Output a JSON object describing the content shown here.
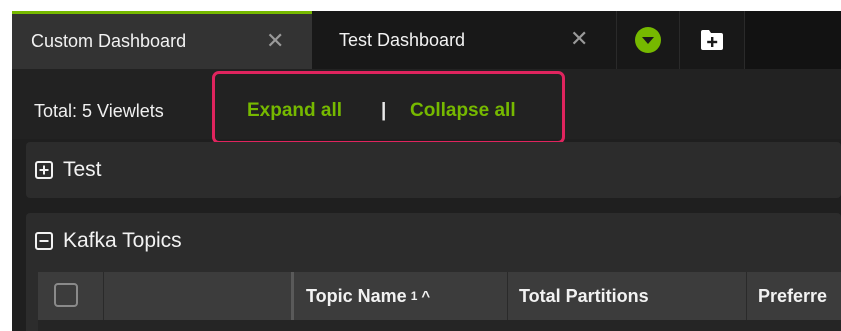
{
  "tabs": [
    {
      "label": "Custom Dashboard",
      "active": true
    },
    {
      "label": "Test Dashboard",
      "active": false
    }
  ],
  "toolbar": {
    "total_label": "Total: 5 Viewlets",
    "expand_all": "Expand all",
    "separator": "|",
    "collapse_all": "Collapse all"
  },
  "panels": [
    {
      "title": "Test",
      "state": "collapsed"
    },
    {
      "title": "Kafka Topics",
      "state": "expanded"
    }
  ],
  "table": {
    "columns": [
      {
        "label": "Topic Name",
        "sort_order": "1",
        "sort_dir": "^"
      },
      {
        "label": "Total Partitions"
      },
      {
        "label": "Preferre"
      }
    ]
  },
  "colors": {
    "accent": "#76b900",
    "highlight": "#e0245e",
    "background": "#1f1f1f"
  },
  "icons": {
    "tab_close": "close-icon",
    "dropdown": "chevron-down-icon",
    "new_dashboard": "add-folder-icon",
    "panel_collapsed": "plus-square-icon",
    "panel_expanded": "minus-square-icon"
  }
}
